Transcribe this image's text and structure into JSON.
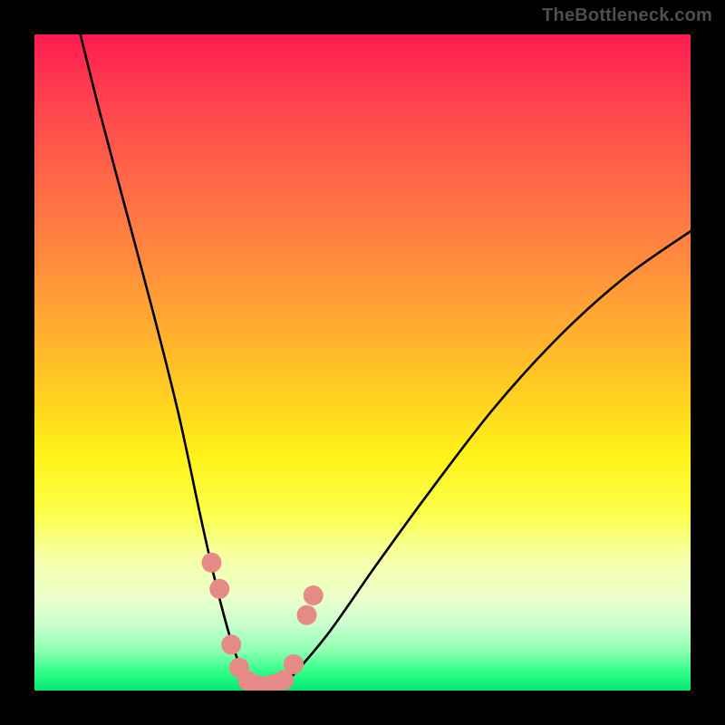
{
  "watermark": {
    "text": "TheBottleneck.com"
  },
  "chart_data": {
    "type": "line",
    "title": "",
    "xlabel": "",
    "ylabel": "",
    "xlim": [
      0,
      100
    ],
    "ylim": [
      0,
      100
    ],
    "grid": false,
    "legend": false,
    "series": [
      {
        "name": "curve",
        "x": [
          7,
          10,
          14,
          18,
          22,
          25,
          27,
          29,
          30.5,
          32,
          33.5,
          35,
          36,
          38,
          40,
          45,
          52,
          60,
          70,
          80,
          90,
          100
        ],
        "y": [
          100,
          88,
          73,
          58,
          42,
          28,
          19,
          11,
          6,
          2.5,
          1,
          0.5,
          0.5,
          1.2,
          3,
          9,
          19,
          30,
          43,
          54,
          63,
          70
        ]
      }
    ],
    "markers": [
      {
        "name": "dots",
        "color": "#e58a86",
        "points": [
          {
            "x": 27.0,
            "y": 19.5
          },
          {
            "x": 28.2,
            "y": 15.5
          },
          {
            "x": 30.0,
            "y": 7.0
          },
          {
            "x": 31.2,
            "y": 3.5
          },
          {
            "x": 32.5,
            "y": 1.5
          },
          {
            "x": 34.0,
            "y": 0.8
          },
          {
            "x": 35.0,
            "y": 0.7
          },
          {
            "x": 36.5,
            "y": 1.0
          },
          {
            "x": 38.0,
            "y": 1.6
          },
          {
            "x": 39.5,
            "y": 4.0
          },
          {
            "x": 41.5,
            "y": 11.5
          },
          {
            "x": 42.5,
            "y": 14.5
          }
        ]
      }
    ]
  }
}
